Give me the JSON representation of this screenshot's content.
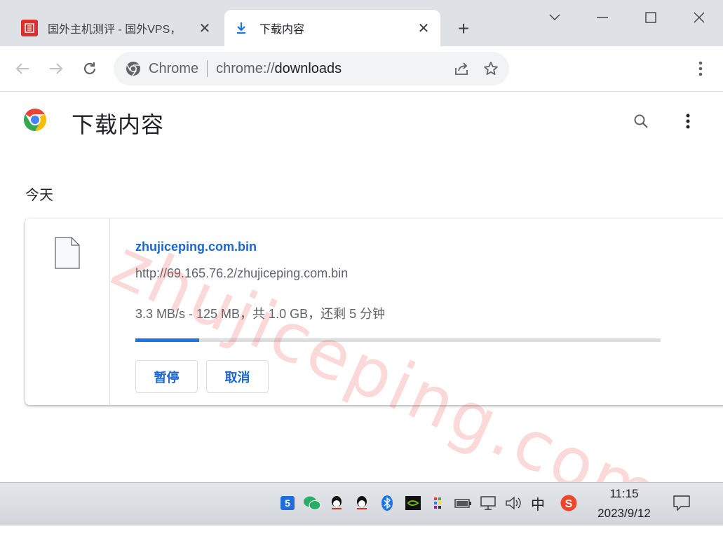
{
  "tabs": [
    {
      "title": "国外主机测评 - 国外VPS，",
      "favicon": "zhujiceping-seal-icon"
    },
    {
      "title": "下载内容",
      "favicon": "download-icon"
    }
  ],
  "omnibox": {
    "label": "Chrome",
    "url_scheme": "chrome://",
    "url_host": "downloads"
  },
  "page": {
    "title": "下载内容"
  },
  "section_label": "今天",
  "download": {
    "file_name": "zhujiceping.com.bin",
    "url": "http://69.165.76.2/zhujiceping.com.bin",
    "status": "3.3 MB/s - 125 MB，共 1.0 GB，还剩 5 分钟",
    "progress_fraction": 0.122,
    "pause_label": "暂停",
    "cancel_label": "取消"
  },
  "watermark": "zhujiceping.com",
  "taskbar": {
    "time": "11:15",
    "date": "2023/9/12",
    "ime_label": "中"
  },
  "colors": {
    "accent": "#1a73e8",
    "tab_strip": "#dee1e6",
    "watermark": "#eb5050"
  }
}
